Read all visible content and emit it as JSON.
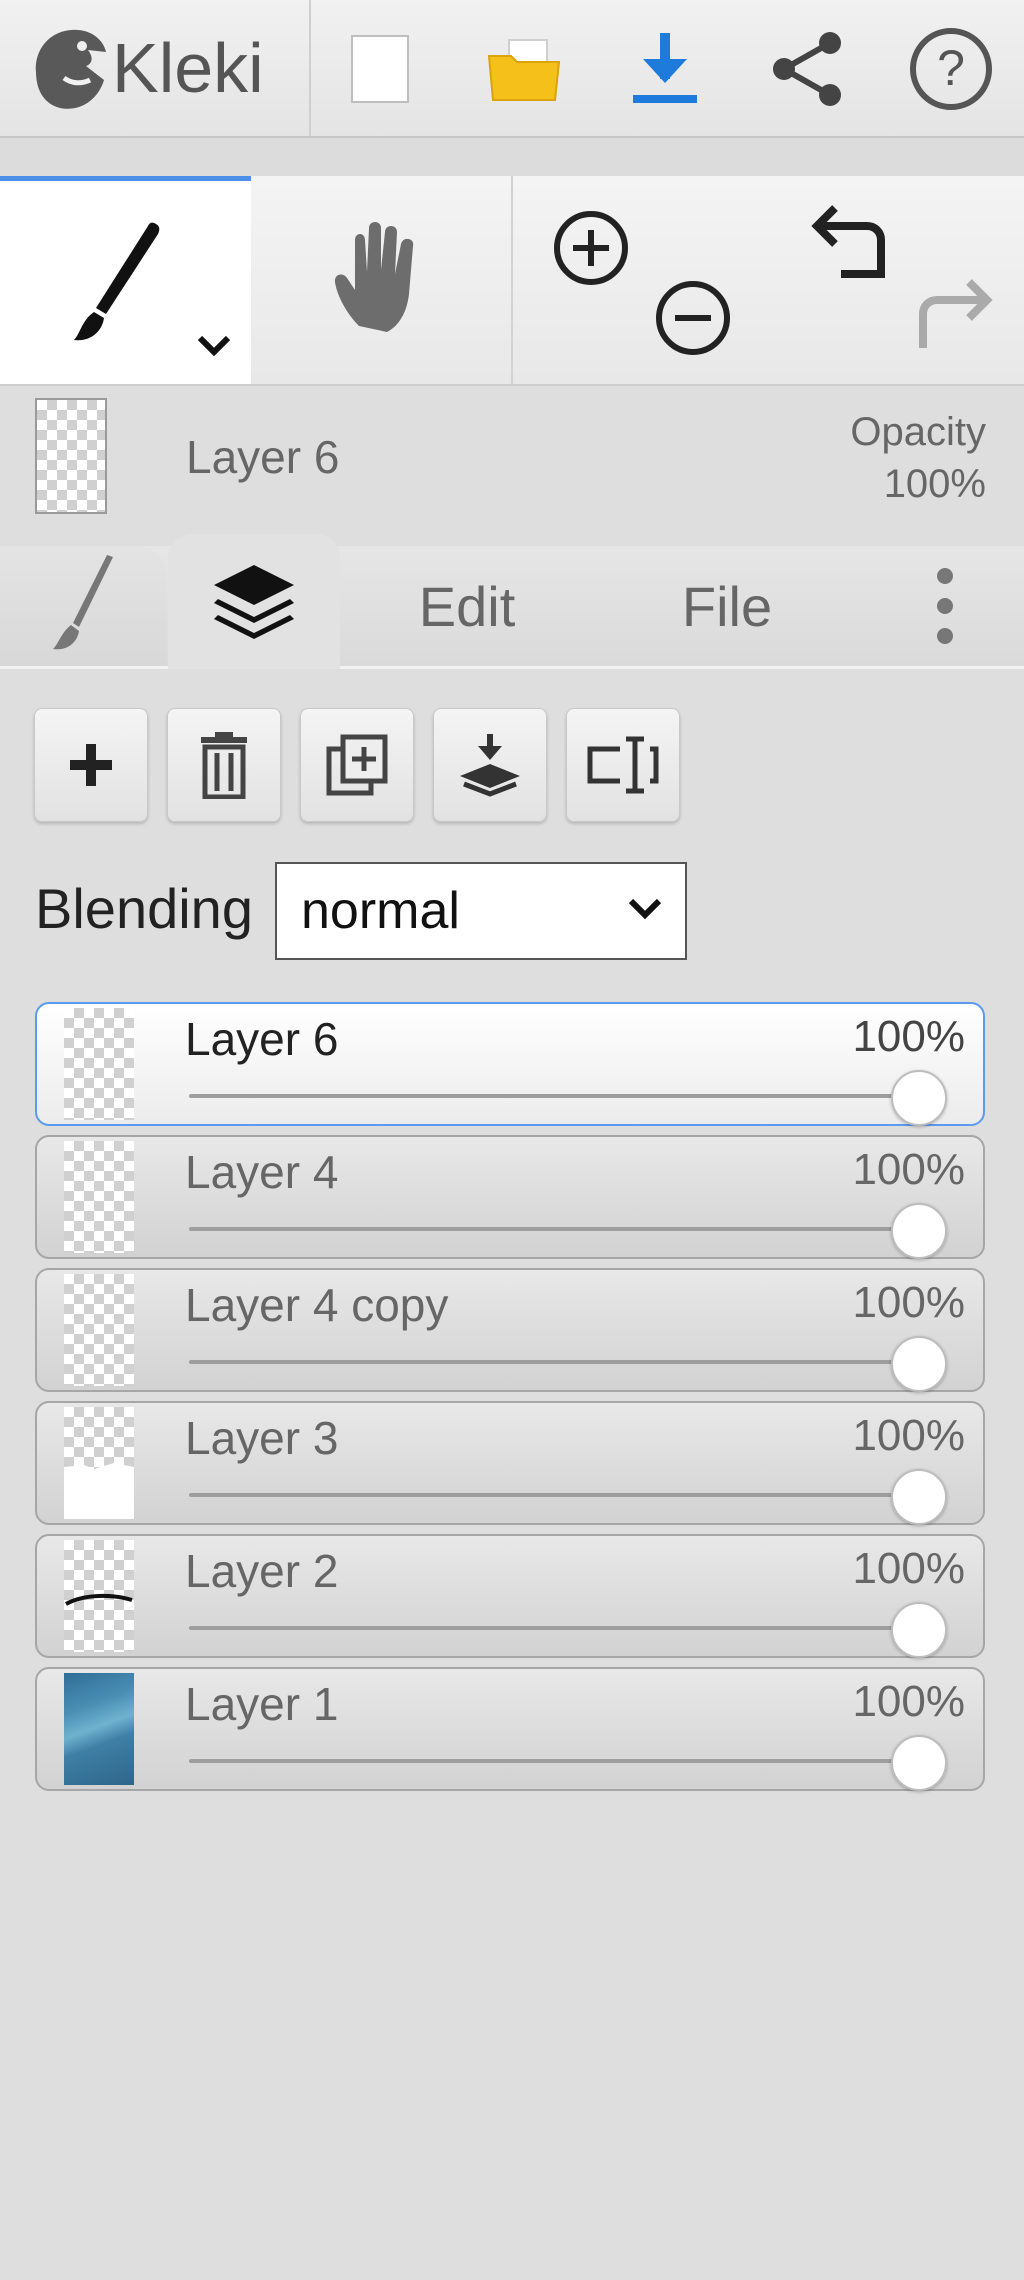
{
  "app": {
    "name": "Kleki"
  },
  "toolbar": {
    "icons": [
      "new-image-icon",
      "open-folder-icon",
      "download-icon",
      "share-icon",
      "help-icon"
    ],
    "download_color": "#1e7bdc"
  },
  "tools": [
    "brush-tool-icon",
    "hand-tool-icon",
    "zoom-in-icon",
    "zoom-out-icon",
    "undo-icon",
    "redo-icon"
  ],
  "current_layer": {
    "name": "Layer 6",
    "opacity_label": "Opacity",
    "opacity_value": "100%"
  },
  "tabs": {
    "edit": "Edit",
    "file": "File"
  },
  "layer_actions": [
    "add-layer-icon",
    "delete-layer-icon",
    "duplicate-layer-icon",
    "merge-down-icon",
    "rename-layer-icon"
  ],
  "blending": {
    "label": "Blending",
    "value": "normal"
  },
  "layers": [
    {
      "name": "Layer 6",
      "opacity": "100%",
      "opacity_value": 1.0,
      "active": true
    },
    {
      "name": "Layer 4",
      "opacity": "100%",
      "opacity_value": 1.0,
      "active": false
    },
    {
      "name": "Layer 4 copy",
      "opacity": "100%",
      "opacity_value": 1.0,
      "active": false
    },
    {
      "name": "Layer 3",
      "opacity": "100%",
      "opacity_value": 1.0,
      "active": false
    },
    {
      "name": "Layer 2",
      "opacity": "100%",
      "opacity_value": 1.0,
      "active": false
    },
    {
      "name": "Layer 1",
      "opacity": "100%",
      "opacity_value": 1.0,
      "active": false
    }
  ],
  "colors": {
    "accent": "#4a8ee8",
    "active_layer_border": "#5a9bf0",
    "folder_yellow": "#f5c01a"
  }
}
